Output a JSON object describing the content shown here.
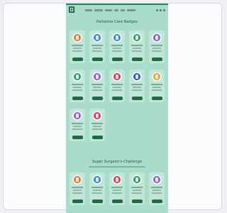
{
  "nav": [
    "",
    "",
    "",
    "",
    "",
    ""
  ],
  "sections": [
    {
      "title": "Palliative Care Badges",
      "subtitle": ""
    },
    {
      "title": "Super Surgeon's Challenge",
      "subtitle": ""
    }
  ],
  "cards": [
    {
      "title": "",
      "button": "",
      "color": "#e07a3a"
    },
    {
      "title": "",
      "button": "",
      "color": "#3a86d8"
    },
    {
      "title": "",
      "button": "",
      "color": "#3a86d8"
    },
    {
      "title": "",
      "button": "",
      "color": "#2f9a64"
    },
    {
      "title": "",
      "button": "",
      "color": "#8a5cc8"
    },
    {
      "title": "",
      "button": "",
      "color": "#2f9a64"
    },
    {
      "title": "",
      "button": "",
      "color": "#9b59d0"
    },
    {
      "title": "",
      "button": "",
      "color": "#d93b5a"
    },
    {
      "title": "",
      "button": "",
      "color": "#2f56c8"
    },
    {
      "title": "",
      "button": "",
      "color": "#e6a62a"
    },
    {
      "title": "",
      "button": "",
      "color": "#9b59d0"
    },
    {
      "title": "",
      "button": "",
      "color": "#d93b5a"
    },
    {
      "title": "",
      "button": "",
      "color": "#e07a3a"
    },
    {
      "title": "",
      "button": "",
      "color": "#3a86d8"
    },
    {
      "title": "",
      "button": "",
      "color": "#d93b5a"
    },
    {
      "title": "",
      "button": "",
      "color": "#2f9a64"
    },
    {
      "title": "",
      "button": "",
      "color": "#9b59d0"
    }
  ]
}
